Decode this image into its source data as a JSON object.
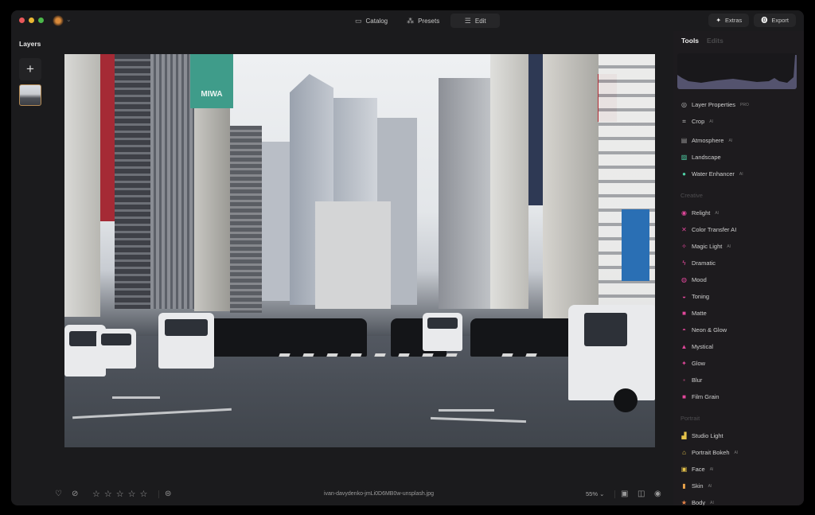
{
  "window": {
    "traffic_lights": [
      "close",
      "minimize",
      "maximize"
    ],
    "app_icon": "sun-icon"
  },
  "nav": {
    "items": [
      {
        "label": "Catalog",
        "icon": "folder-icon",
        "active": false
      },
      {
        "label": "Presets",
        "icon": "sparkle-icon",
        "active": false
      },
      {
        "label": "Edit",
        "icon": "sliders-icon",
        "active": true
      }
    ]
  },
  "top_right": {
    "extras_label": "Extras",
    "export_label": "Export"
  },
  "layers": {
    "title": "Layers",
    "add_label": "+"
  },
  "photo": {
    "description": "Tokyo street crosswalk with skyscrapers",
    "signs": {
      "miwa": "MIWA"
    }
  },
  "bottom_bar": {
    "rating": 0,
    "rating_max": 5,
    "filename": "ivan-davydenko-jmLi0D6MB0w-unsplash.jpg",
    "zoom_level": "55%"
  },
  "panel": {
    "tabs": [
      {
        "label": "Tools",
        "active": true
      },
      {
        "label": "Edits",
        "active": false
      }
    ],
    "groups": [
      {
        "title": "",
        "items": [
          {
            "label": "Layer Properties",
            "badge": "PRO",
            "icon": "layers-icon",
            "color": "#bdbdbd"
          },
          {
            "label": "Crop",
            "badge": "AI",
            "icon": "crop-icon",
            "color": "#bdbdbd"
          }
        ]
      },
      {
        "title": "",
        "items": [
          {
            "label": "Atmosphere",
            "badge": "AI",
            "icon": "atmosphere-icon",
            "color": "#9a9a9a"
          },
          {
            "label": "Landscape",
            "badge": "",
            "icon": "landscape-icon",
            "color": "#4fd1a6"
          },
          {
            "label": "Water Enhancer",
            "badge": "AI",
            "icon": "water-drop-icon",
            "color": "#4fd1a6"
          }
        ]
      },
      {
        "title": "Creative",
        "items": [
          {
            "label": "Relight",
            "badge": "AI",
            "icon": "relight-icon",
            "color": "#e0479a"
          },
          {
            "label": "Color Transfer AI",
            "badge": "",
            "icon": "color-transfer-icon",
            "color": "#e0479a"
          },
          {
            "label": "Magic Light",
            "badge": "AI",
            "icon": "magic-light-icon",
            "color": "#e0479a"
          },
          {
            "label": "Dramatic",
            "badge": "",
            "icon": "dramatic-icon",
            "color": "#e0479a"
          },
          {
            "label": "Mood",
            "badge": "",
            "icon": "mood-icon",
            "color": "#e0479a"
          },
          {
            "label": "Toning",
            "badge": "",
            "icon": "toning-icon",
            "color": "#e0479a"
          },
          {
            "label": "Matte",
            "badge": "",
            "icon": "matte-icon",
            "color": "#e0479a"
          },
          {
            "label": "Neon & Glow",
            "badge": "",
            "icon": "neon-icon",
            "color": "#e0479a"
          },
          {
            "label": "Mystical",
            "badge": "",
            "icon": "mystical-icon",
            "color": "#e0479a"
          },
          {
            "label": "Glow",
            "badge": "",
            "icon": "glow-icon",
            "color": "#e0479a"
          },
          {
            "label": "Blur",
            "badge": "",
            "icon": "blur-icon",
            "color": "#8a3a62"
          },
          {
            "label": "Film Grain",
            "badge": "",
            "icon": "film-grain-icon",
            "color": "#e0479a"
          }
        ]
      },
      {
        "title": "Portrait",
        "items": [
          {
            "label": "Studio Light",
            "badge": "",
            "icon": "studio-light-icon",
            "color": "#e6c34a"
          },
          {
            "label": "Portrait Bokeh",
            "badge": "AI",
            "icon": "bokeh-icon",
            "color": "#e6c34a"
          },
          {
            "label": "Face",
            "badge": "AI",
            "icon": "face-icon",
            "color": "#e6c34a"
          },
          {
            "label": "Skin",
            "badge": "AI",
            "icon": "skin-icon",
            "color": "#e8a24a"
          },
          {
            "label": "Body",
            "badge": "AI",
            "icon": "body-icon",
            "color": "#e8844a"
          }
        ]
      }
    ]
  }
}
